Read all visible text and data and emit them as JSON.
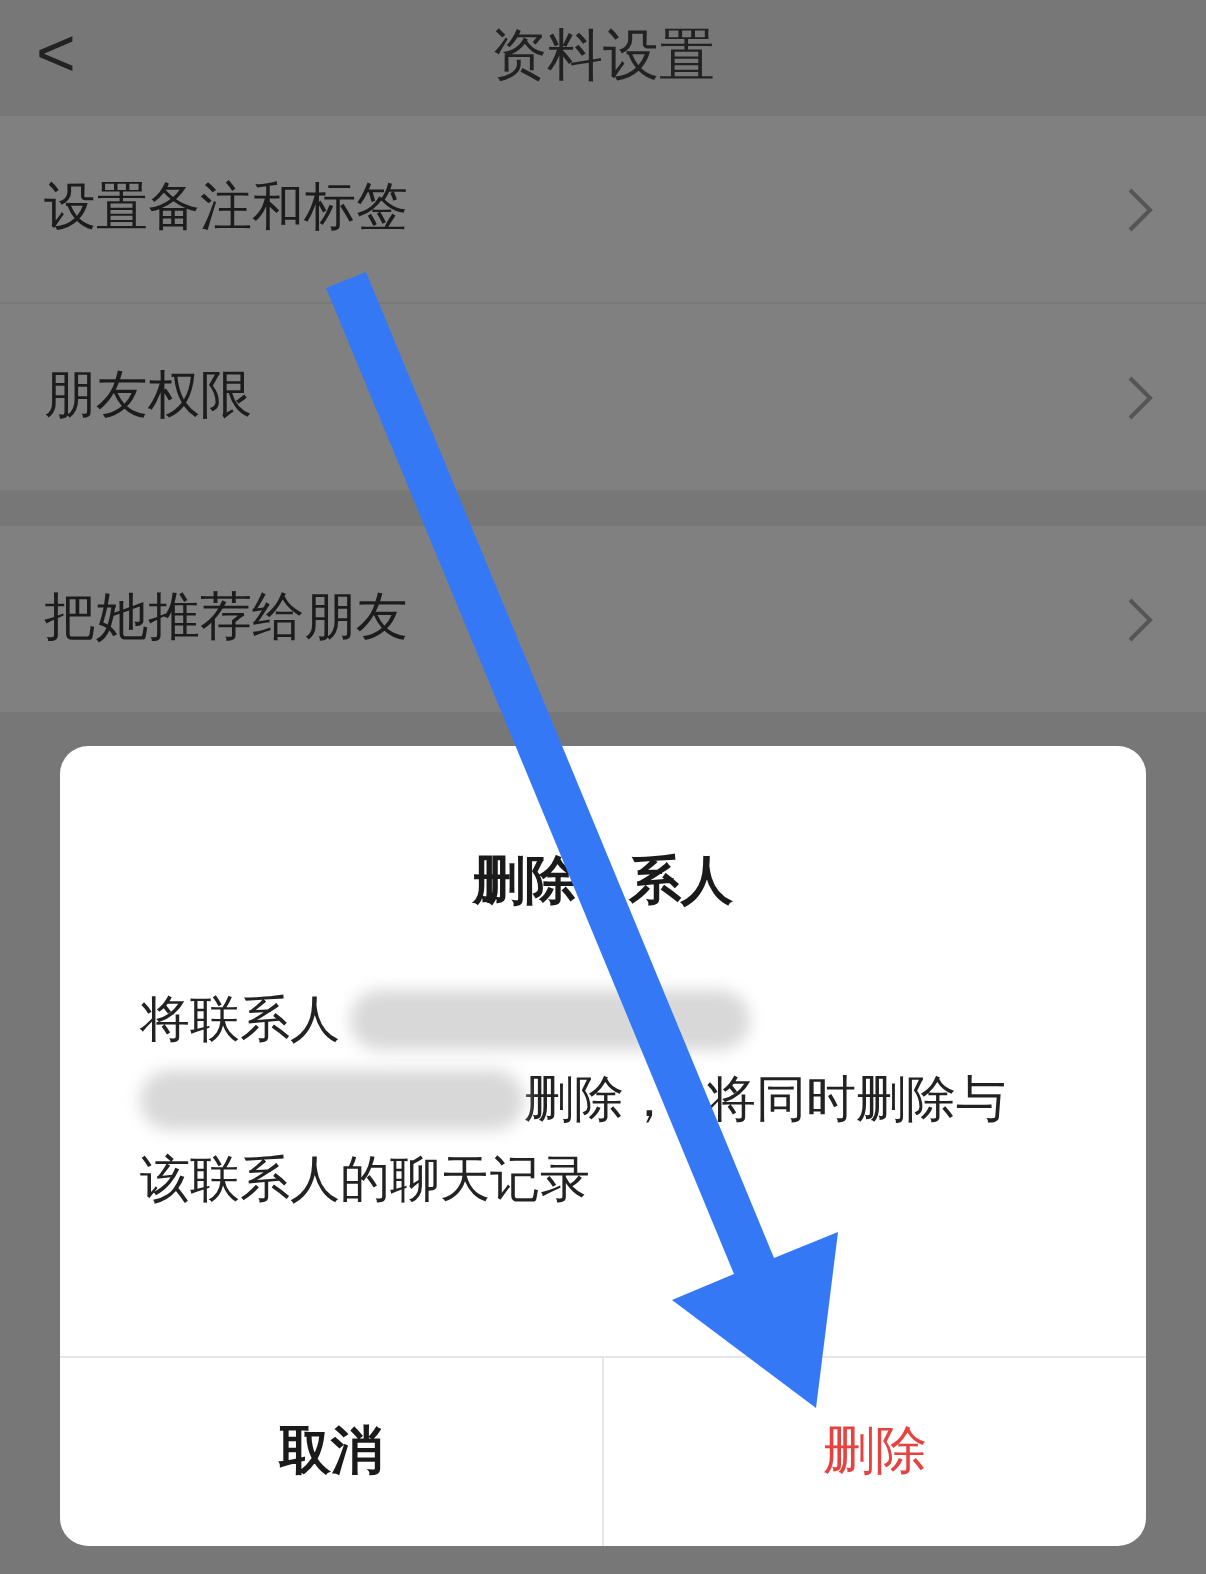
{
  "header": {
    "back": "<",
    "title": "资料设置"
  },
  "settings_groups": [
    {
      "items": [
        {
          "label": "设置备注和标签"
        },
        {
          "label": "朋友权限"
        }
      ]
    },
    {
      "items": [
        {
          "label": "把她推荐给朋友"
        }
      ]
    }
  ],
  "dialog": {
    "title_parts": [
      "删除",
      "系人"
    ],
    "message_lines": [
      [
        {
          "kind": "text",
          "text": "将联系人"
        },
        {
          "kind": "redacted"
        }
      ],
      [
        {
          "kind": "redacted"
        },
        {
          "kind": "text",
          "text": "删除，"
        },
        {
          "kind": "text",
          "text": "将同时删除与"
        }
      ],
      [
        {
          "kind": "text",
          "text": "该联系人的聊天记录"
        }
      ]
    ],
    "buttons": [
      {
        "label": "取消",
        "kind": "cancel"
      },
      {
        "label": "删除",
        "kind": "destructive"
      }
    ]
  }
}
